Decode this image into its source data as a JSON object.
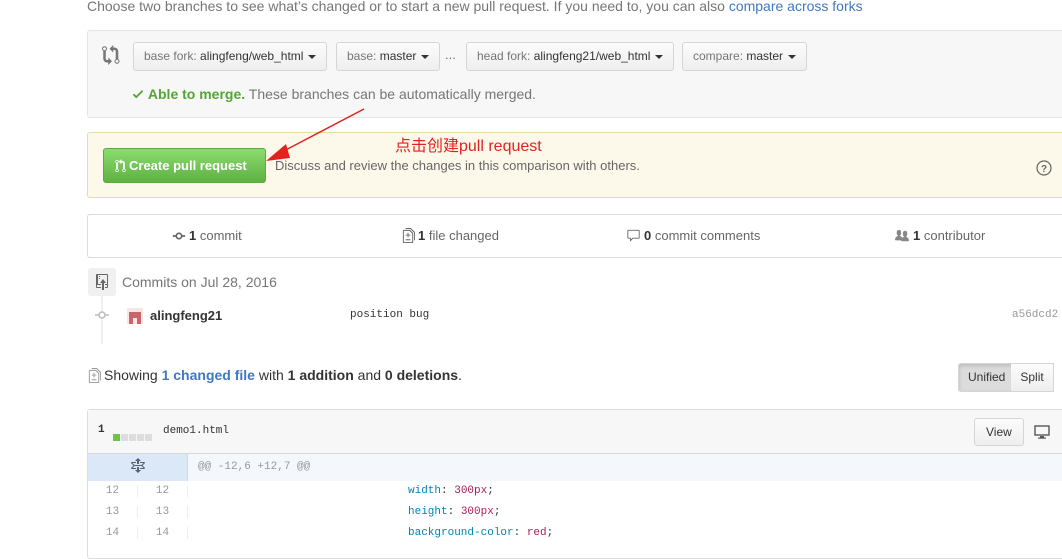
{
  "intro": {
    "text": "Choose two branches to see what’s changed or to start a new pull request. If you need to, you can also ",
    "link": "compare across forks"
  },
  "range": {
    "base_fork_label": "base fork:",
    "base_fork_value": "alingfeng/web_html",
    "base_label": "base:",
    "base_value": "master",
    "separator": "...",
    "head_fork_label": "head fork:",
    "head_fork_value": "alingfeng21/web_html",
    "compare_label": "compare:",
    "compare_value": "master",
    "merge_ok": "Able to merge.",
    "merge_note": "These branches can be automatically merged."
  },
  "pull_request": {
    "button_label": "Create pull request",
    "description": "Discuss and review the changes in this comparison with others."
  },
  "annotation": "点击创建pull request",
  "numbers": {
    "commits_count": "1",
    "commits_label": "commit",
    "files_count": "1",
    "files_label": "file changed",
    "comments_count": "0",
    "comments_label": "commit comments",
    "contributors_count": "1",
    "contributors_label": "contributor"
  },
  "commits": {
    "date_heading": "Commits on Jul 28, 2016",
    "items": [
      {
        "author": "alingfeng21",
        "message": "position bug",
        "sha": "a56dcd2"
      }
    ]
  },
  "file_summary": {
    "prefix": "Showing",
    "changed_files": "1 changed file",
    "mid": "with",
    "additions": "1 addition",
    "and": "and",
    "deletions": "0 deletions",
    "end": "."
  },
  "diff_view": {
    "unified_label": "Unified",
    "split_label": "Split",
    "selected": "Unified"
  },
  "file": {
    "changes": "1",
    "name": "demo1.html",
    "view_label": "View",
    "hunk_header": "@@ -12,6 +12,7 @@",
    "lines": [
      {
        "old": "12",
        "new": "12",
        "prop": "width",
        "value": "300px"
      },
      {
        "old": "13",
        "new": "13",
        "prop": "height",
        "value": "300px"
      },
      {
        "old": "14",
        "new": "14",
        "prop": "background-color",
        "value": "red"
      }
    ]
  },
  "colors": {
    "link": "#4078c0",
    "merge_ok": "#55a532",
    "create_button": "#60b044",
    "annotation": "#e4221d"
  }
}
